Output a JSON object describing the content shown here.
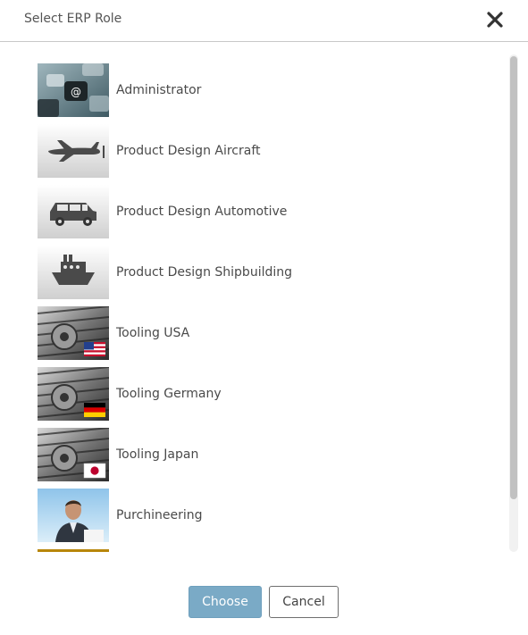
{
  "dialog": {
    "title": "Select ERP Role",
    "close_icon": "close-icon"
  },
  "roles": [
    {
      "label": "Administrator",
      "icon": "keyboard-at-key-image"
    },
    {
      "label": "Product Design Aircraft",
      "icon": "airplane-icon"
    },
    {
      "label": "Product Design Automotive",
      "icon": "car-icon"
    },
    {
      "label": "Product Design Shipbuilding",
      "icon": "ship-icon"
    },
    {
      "label": "Tooling USA",
      "icon": "gears-usa-flag-image"
    },
    {
      "label": "Tooling Germany",
      "icon": "gears-germany-flag-image"
    },
    {
      "label": "Tooling Japan",
      "icon": "gears-japan-flag-image"
    },
    {
      "label": "Purchineering",
      "icon": "businessman-photo"
    }
  ],
  "buttons": {
    "choose": "Choose",
    "cancel": "Cancel"
  },
  "colors": {
    "primary_button": "#7aaac6",
    "divider": "#c8c8c8",
    "scrollbar_thumb": "#c1c1c1"
  }
}
